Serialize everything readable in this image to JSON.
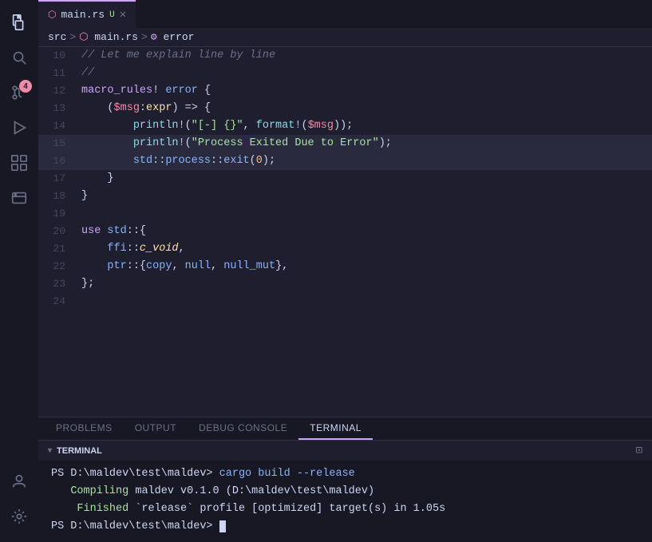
{
  "activityBar": {
    "icons": [
      {
        "name": "files-icon",
        "symbol": "⎗",
        "active": true,
        "badge": null
      },
      {
        "name": "search-icon",
        "symbol": "⌕",
        "active": false,
        "badge": null
      },
      {
        "name": "source-control-icon",
        "symbol": "⑂",
        "active": false,
        "badge": "4"
      },
      {
        "name": "run-debug-icon",
        "symbol": "▷",
        "active": false,
        "badge": null
      },
      {
        "name": "extensions-icon",
        "symbol": "⊞",
        "active": false,
        "badge": null
      },
      {
        "name": "remote-icon",
        "symbol": "⊡",
        "active": false,
        "badge": null
      }
    ],
    "bottomIcons": [
      {
        "name": "account-icon",
        "symbol": "◯"
      },
      {
        "name": "settings-icon",
        "symbol": "⚙"
      }
    ]
  },
  "tabBar": {
    "tabs": [
      {
        "id": "main-rs-tab",
        "filename": "main.rs",
        "modified": "U",
        "active": true,
        "icon": "rust-icon"
      }
    ]
  },
  "breadcrumb": {
    "parts": [
      "src",
      ">",
      "main.rs",
      ">",
      "error"
    ]
  },
  "editor": {
    "lines": [
      {
        "num": 10,
        "tokens": [
          {
            "cls": "comment",
            "text": "// Let me explain line by line"
          }
        ]
      },
      {
        "num": 11,
        "tokens": [
          {
            "cls": "comment",
            "text": "//"
          }
        ]
      },
      {
        "num": 12,
        "tokens": [
          {
            "cls": "kw",
            "text": "macro_rules"
          },
          {
            "cls": "plain",
            "text": "! "
          },
          {
            "cls": "fn-name",
            "text": "error"
          },
          {
            "cls": "plain",
            "text": " {"
          }
        ]
      },
      {
        "num": 13,
        "tokens": [
          {
            "cls": "plain",
            "text": "    ("
          },
          {
            "cls": "var",
            "text": "$msg"
          },
          {
            "cls": "plain",
            "text": ":"
          },
          {
            "cls": "type",
            "text": "expr"
          },
          {
            "cls": "plain",
            "text": ") => {"
          }
        ]
      },
      {
        "num": 14,
        "tokens": [
          {
            "cls": "plain",
            "text": "        "
          },
          {
            "cls": "macro",
            "text": "println!"
          },
          {
            "cls": "plain",
            "text": "("
          },
          {
            "cls": "string",
            "text": "\"[-] {}\""
          },
          {
            "cls": "plain",
            "text": ", "
          },
          {
            "cls": "macro",
            "text": "format!"
          },
          {
            "cls": "plain",
            "text": "("
          },
          {
            "cls": "var",
            "text": "$msg"
          },
          {
            "cls": "plain",
            "text": "));"
          }
        ]
      },
      {
        "num": 15,
        "tokens": [
          {
            "cls": "plain",
            "text": "        "
          },
          {
            "cls": "macro",
            "text": "println!"
          },
          {
            "cls": "plain",
            "text": "("
          },
          {
            "cls": "string",
            "text": "\"Process Exited Due to Error\""
          },
          {
            "cls": "plain",
            "text": ");"
          }
        ],
        "highlight": true
      },
      {
        "num": 16,
        "tokens": [
          {
            "cls": "plain",
            "text": "        "
          },
          {
            "cls": "fn-name",
            "text": "std"
          },
          {
            "cls": "plain",
            "text": "::"
          },
          {
            "cls": "fn-name",
            "text": "process"
          },
          {
            "cls": "plain",
            "text": "::"
          },
          {
            "cls": "fn-name",
            "text": "exit"
          },
          {
            "cls": "plain",
            "text": "("
          },
          {
            "cls": "num",
            "text": "0"
          },
          {
            "cls": "plain",
            "text": ");"
          }
        ],
        "highlight": true
      },
      {
        "num": 17,
        "tokens": [
          {
            "cls": "plain",
            "text": "    }"
          }
        ]
      },
      {
        "num": 18,
        "tokens": [
          {
            "cls": "plain",
            "text": "}"
          }
        ]
      },
      {
        "num": 19,
        "tokens": []
      },
      {
        "num": 20,
        "tokens": [
          {
            "cls": "kw",
            "text": "use "
          },
          {
            "cls": "fn-name",
            "text": "std"
          },
          {
            "cls": "plain",
            "text": "::{"
          }
        ]
      },
      {
        "num": 21,
        "tokens": [
          {
            "cls": "plain",
            "text": "    "
          },
          {
            "cls": "fn-name",
            "text": "ffi"
          },
          {
            "cls": "plain",
            "text": "::"
          },
          {
            "cls": "type italic",
            "text": "c_void"
          },
          {
            "cls": "plain",
            "text": ","
          }
        ]
      },
      {
        "num": 22,
        "tokens": [
          {
            "cls": "plain",
            "text": "    "
          },
          {
            "cls": "fn-name",
            "text": "ptr"
          },
          {
            "cls": "plain",
            "text": "::{"
          },
          {
            "cls": "fn-name",
            "text": "copy"
          },
          {
            "cls": "plain",
            "text": ", "
          },
          {
            "cls": "fn-name",
            "text": "null"
          },
          {
            "cls": "plain",
            "text": ", "
          },
          {
            "cls": "fn-name",
            "text": "null_mut"
          },
          {
            "cls": "plain",
            "text": "},"
          }
        ]
      },
      {
        "num": 23,
        "tokens": [
          {
            "cls": "plain",
            "text": "};"
          }
        ]
      },
      {
        "num": 24,
        "tokens": []
      }
    ]
  },
  "panel": {
    "tabs": [
      {
        "id": "problems-tab",
        "label": "PROBLEMS",
        "active": false
      },
      {
        "id": "output-tab",
        "label": "OUTPUT",
        "active": false
      },
      {
        "id": "debug-console-tab",
        "label": "DEBUG CONSOLE",
        "active": false
      },
      {
        "id": "terminal-tab",
        "label": "TERMINAL",
        "active": true
      }
    ],
    "terminalLabel": "TERMINAL",
    "terminal": {
      "lines": [
        {
          "text": "PS D:\\maldev\\test\\maldev> cargo build --release",
          "type": "plain"
        },
        {
          "text": "   Compiling maldev v0.1.0 (D:\\maldev\\test\\maldev)",
          "type": "compiling"
        },
        {
          "text": "    Finished `release` profile [optimized] target(s) in 1.05s",
          "type": "finished"
        },
        {
          "text": "PS D:\\maldev\\test\\maldev> ",
          "type": "prompt",
          "cursor": true
        }
      ]
    }
  }
}
